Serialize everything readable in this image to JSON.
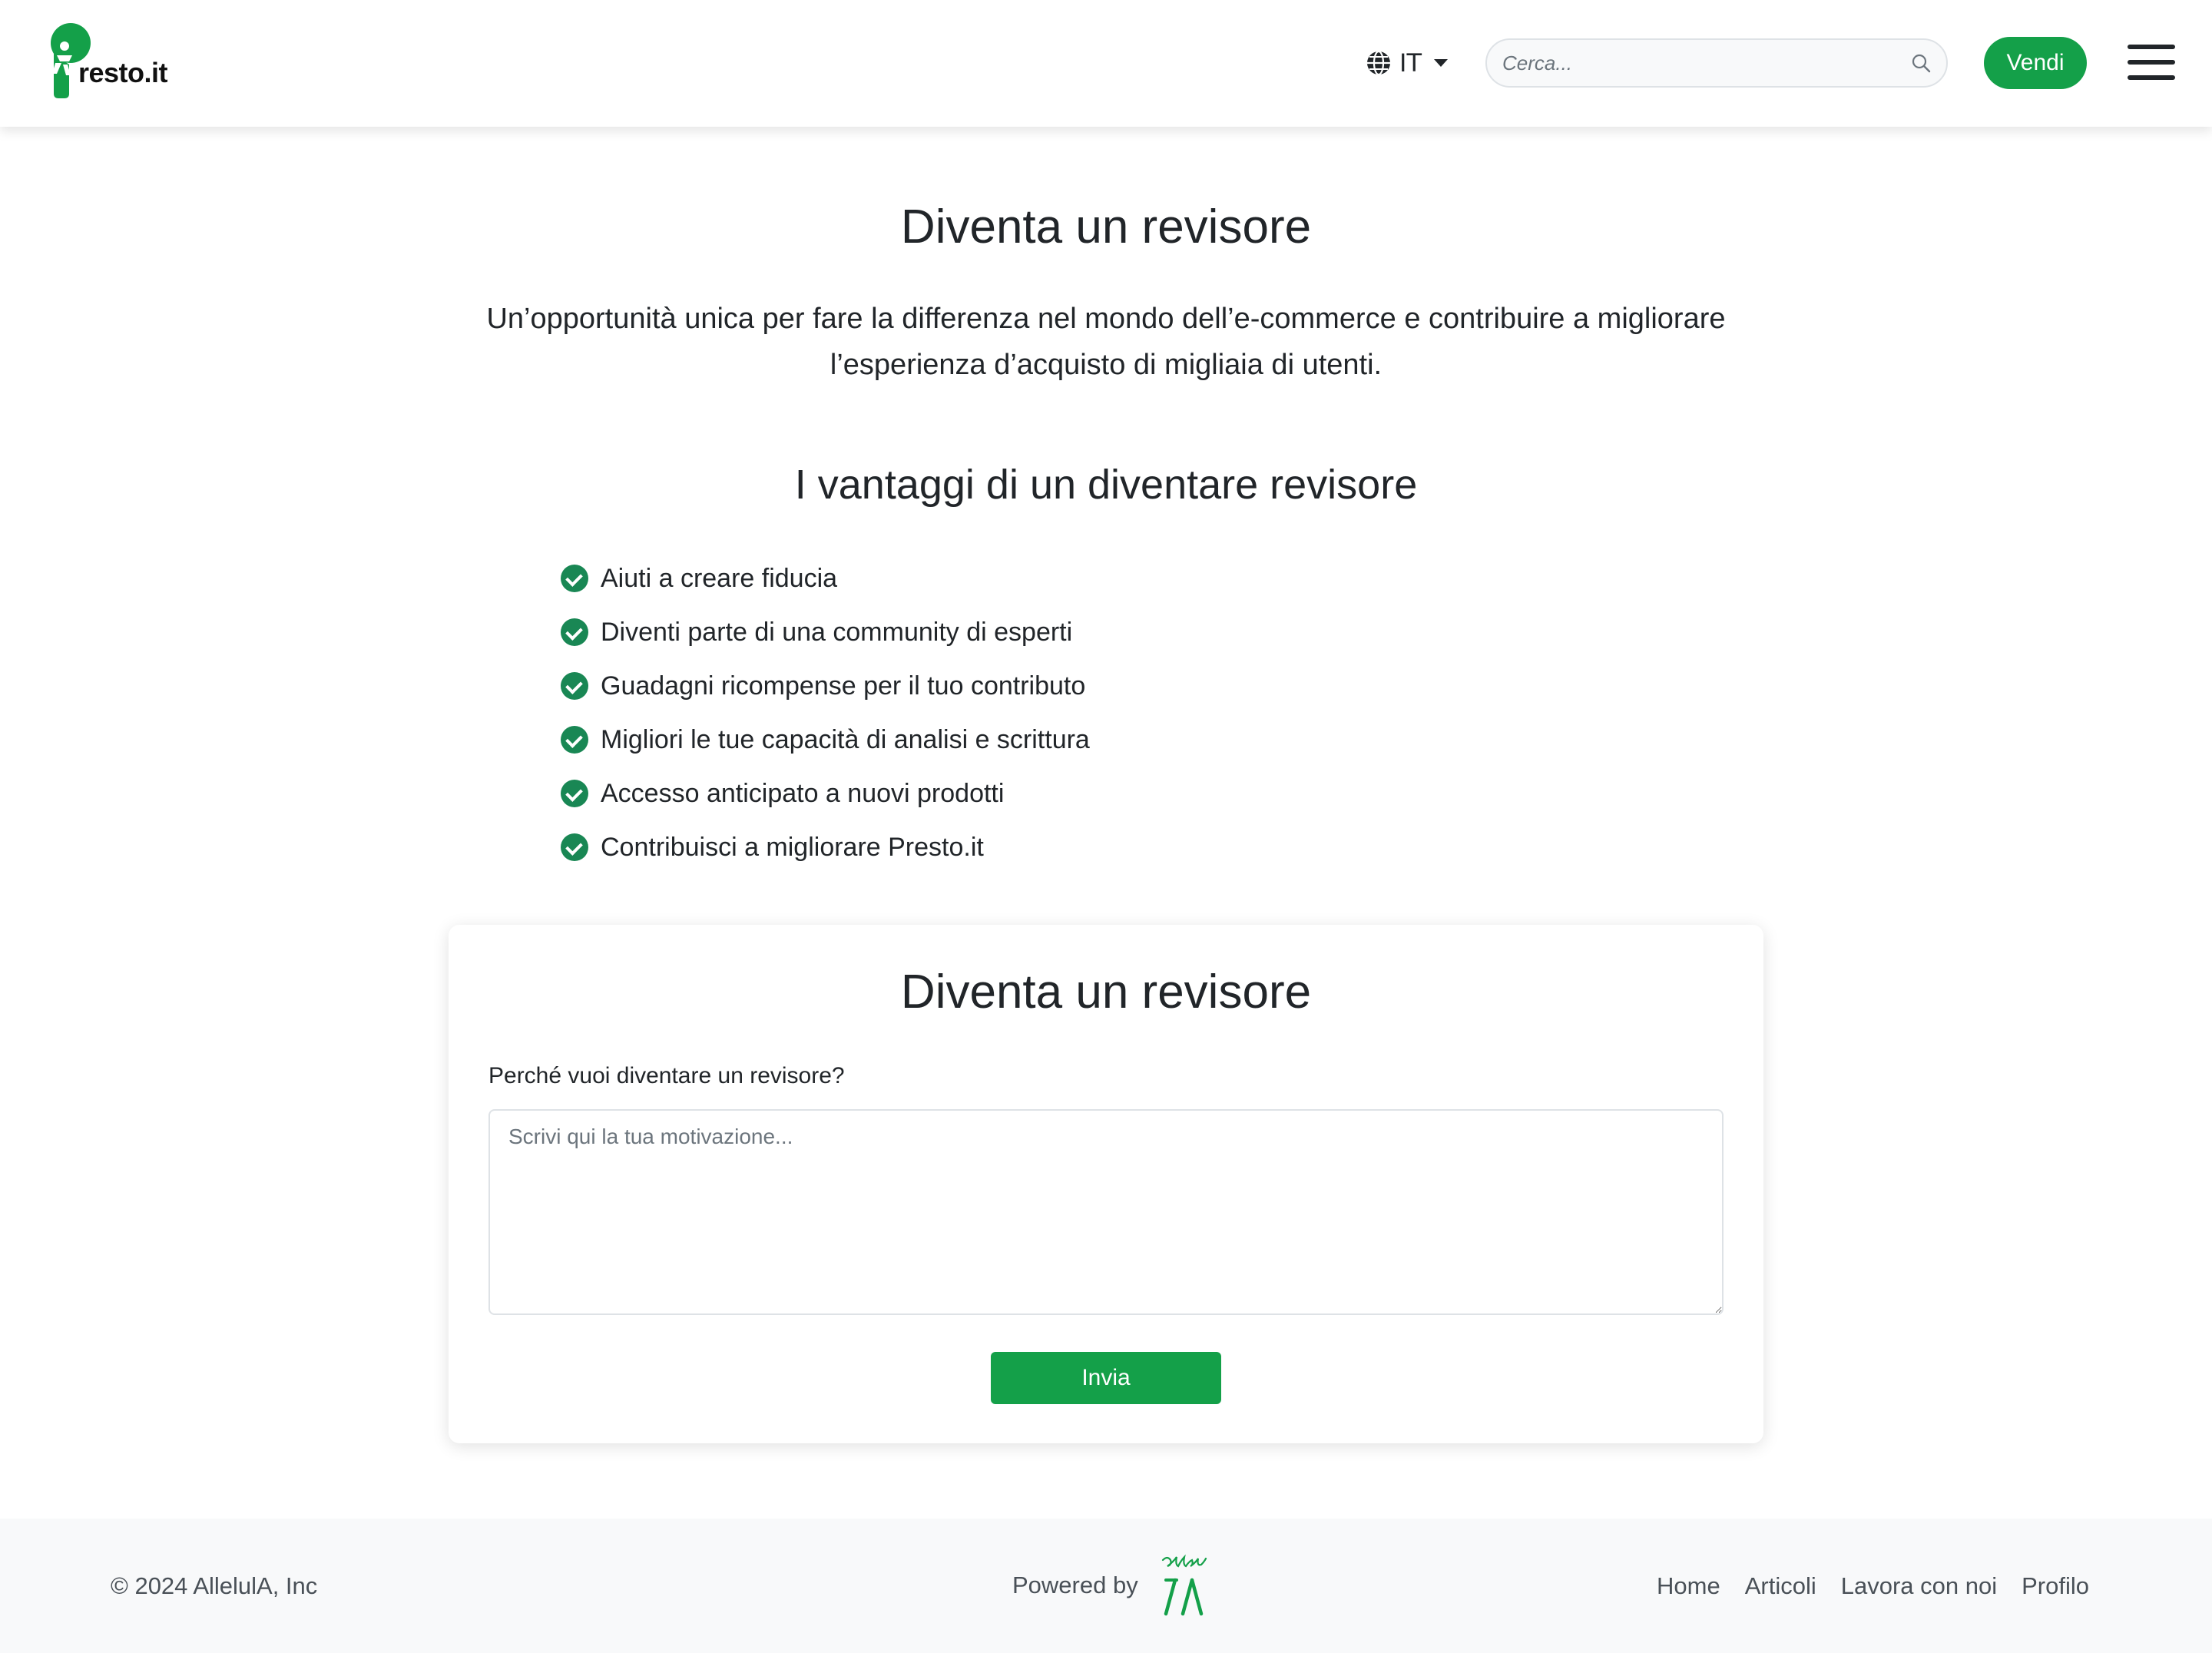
{
  "brand": {
    "logo_text": "resto.it",
    "accent_color": "#14a049"
  },
  "navbar": {
    "language": "IT",
    "language_icon": "globe-icon",
    "search_placeholder": "Cerca...",
    "sell_label": "Vendi",
    "menu_icon": "hamburger-icon"
  },
  "main": {
    "title": "Diventa un revisore",
    "lead": "Un’opportunità unica per fare la differenza nel mondo dell’e-commerce e contribuire a migliorare l’esperienza d’acquisto di migliaia di utenti.",
    "benefits_title": "I vantaggi di un diventare revisore",
    "benefits": [
      "Aiuti a creare fiducia",
      "Diventi parte di una community di esperti",
      "Guadagni ricompense per il tuo contributo",
      "Migliori le tue capacità di analisi e scrittura",
      "Accesso anticipato a nuovi prodotti",
      "Contribuisci a migliorare Presto.it"
    ]
  },
  "form": {
    "title": "Diventa un revisore",
    "label": "Perché vuoi diventare un revisore?",
    "textarea_placeholder": "Scrivi qui la tua motivazione...",
    "submit_label": "Invia"
  },
  "footer": {
    "copyright": "© 2024 AllelulA, Inc",
    "powered_by": "Powered by",
    "links": [
      "Home",
      "Articoli",
      "Lavora con noi",
      "Profilo"
    ]
  }
}
